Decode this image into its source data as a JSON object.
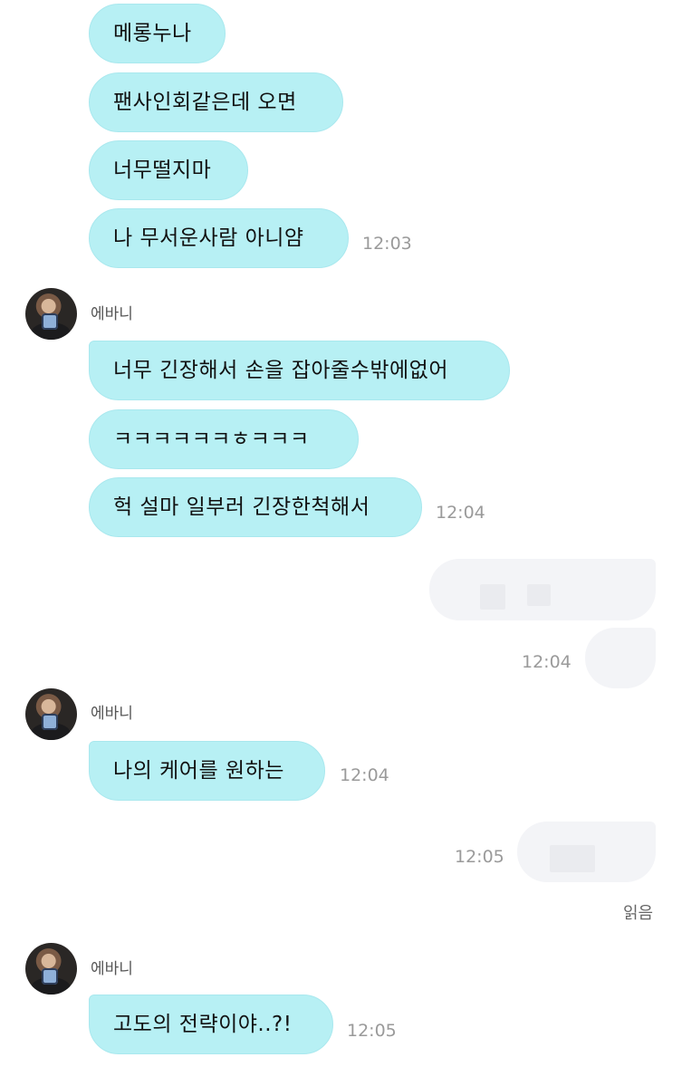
{
  "messages": [
    {
      "text": "메롱누나"
    },
    {
      "text": "팬사인회같은데 오면"
    },
    {
      "text": "너무떨지마"
    },
    {
      "text": "나 무서운사람 아니얌"
    },
    {
      "text": "너무 긴장해서 손을 잡아줄수밖에없어"
    },
    {
      "text": "ㅋㅋㅋㅋㅋㅋㅎㅋㅋㅋ"
    },
    {
      "text": "헉 설마 일부러 긴장한척해서"
    },
    {
      "text": "나의 케어를 원하는"
    },
    {
      "text": "고도의 전략이야..?!"
    }
  ],
  "times": [
    "12:03",
    "12:04",
    "12:04",
    "12:04",
    "12:05",
    "12:05"
  ],
  "sender": {
    "name": "에바니",
    "avatar_icon": "profile-photo"
  },
  "read_receipt": "읽음",
  "colors": {
    "received_bubble": "#b7f0f4",
    "sent_bubble": "#f3f4f7",
    "timestamp": "#9a9a9a"
  }
}
